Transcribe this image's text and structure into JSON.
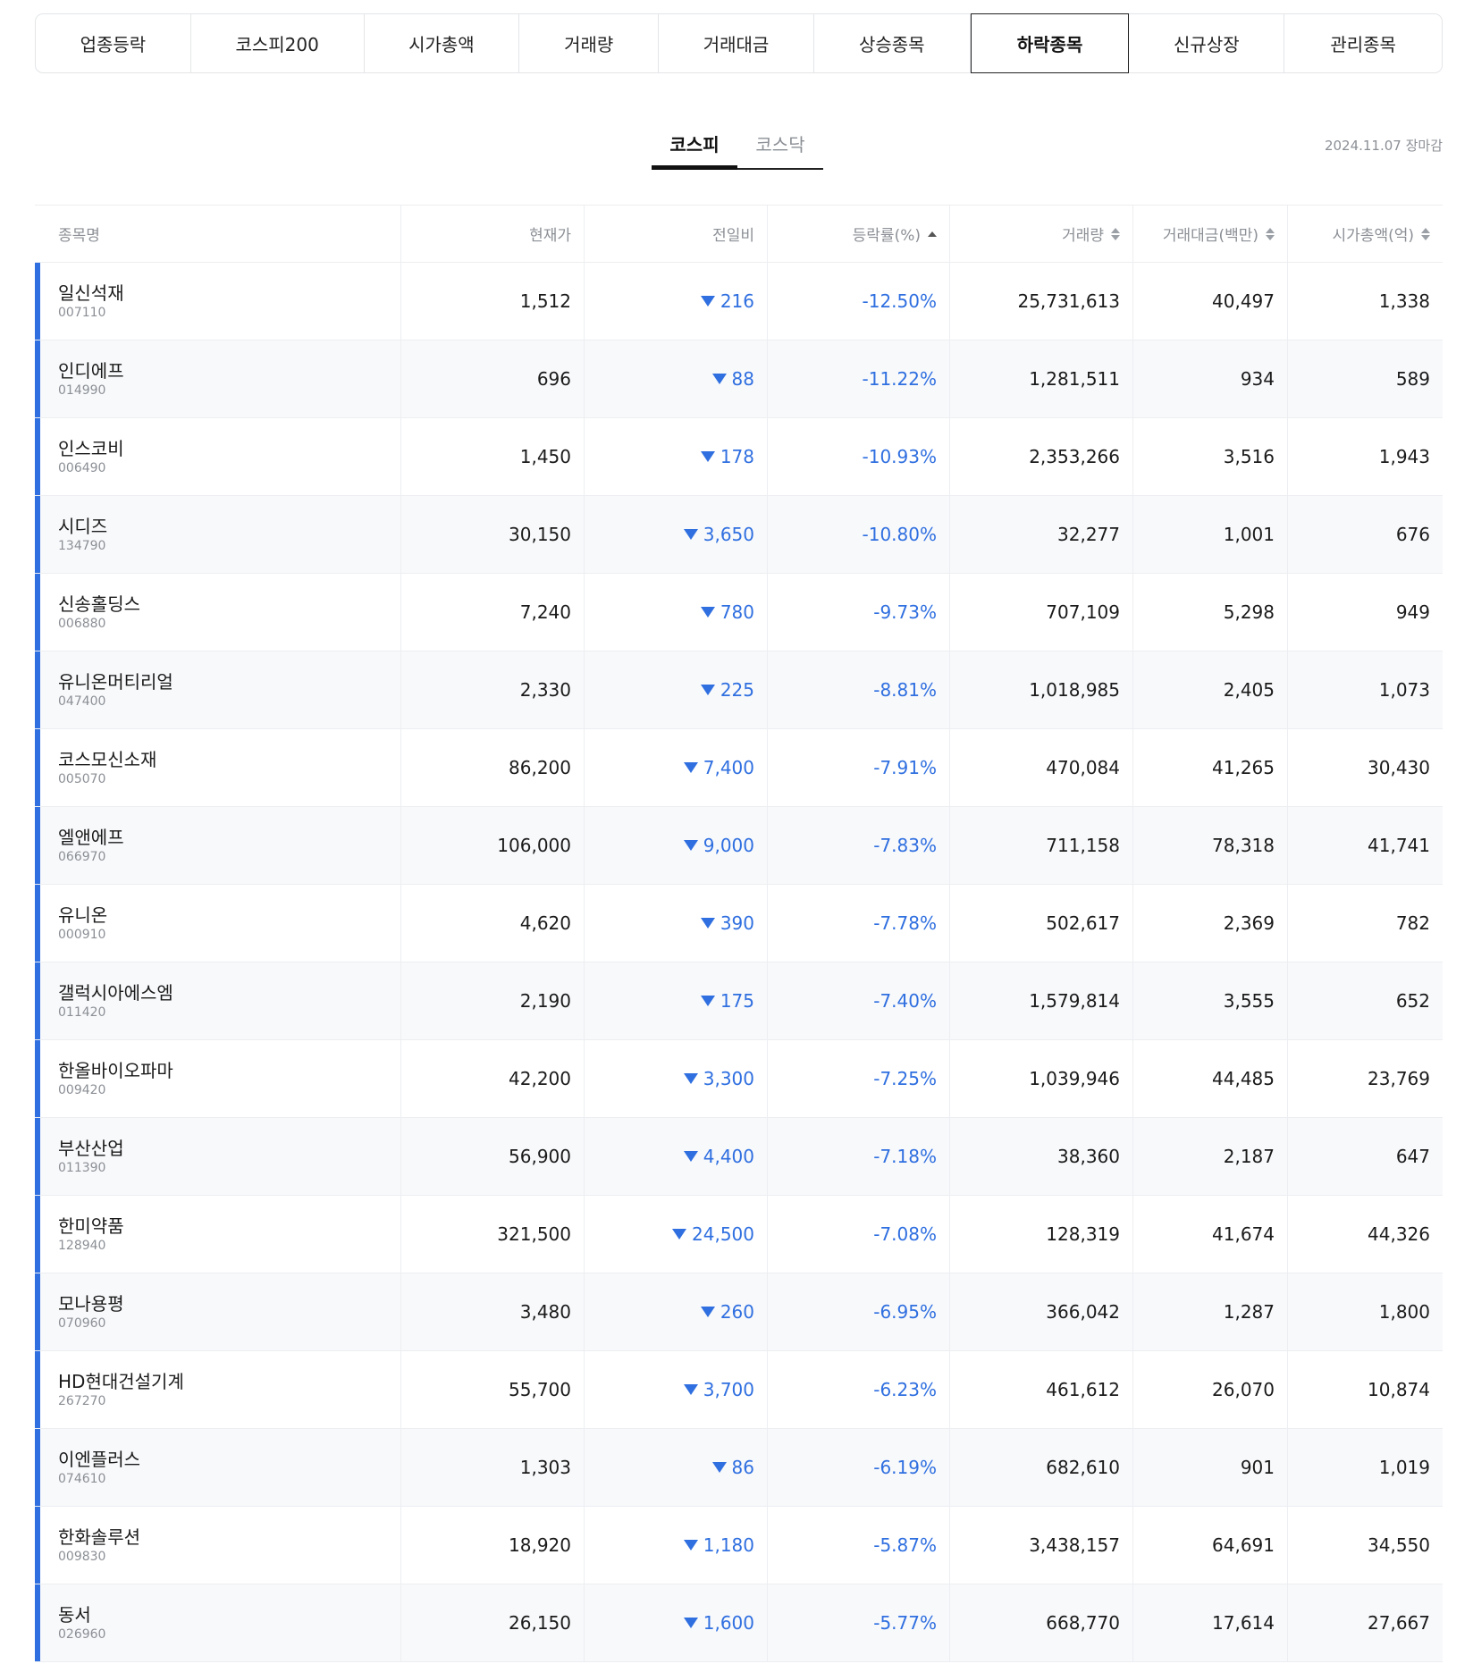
{
  "category_tabs": [
    {
      "label": "업종등락",
      "width": 174
    },
    {
      "label": "코스피200",
      "width": 194
    },
    {
      "label": "시가총액",
      "width": 174
    },
    {
      "label": "거래량",
      "width": 156
    },
    {
      "label": "거래대금",
      "width": 174
    },
    {
      "label": "상승종목",
      "width": 175
    },
    {
      "label": "하락종목",
      "width": 178
    },
    {
      "label": "신규상장",
      "width": 174
    },
    {
      "label": "관리종목",
      "width": 176
    }
  ],
  "active_category": "하락종목",
  "market_tabs": [
    "코스피",
    "코스닥"
  ],
  "active_market": "코스피",
  "date_label": "2024.11.07 장마감",
  "columns": [
    "종목명",
    "현재가",
    "전일비",
    "등락률(%)",
    "거래량",
    "거래대금(백만)",
    "시가총액(억)"
  ],
  "rows": [
    {
      "name": "일신석재",
      "code": "007110",
      "price": "1,512",
      "change": "216",
      "rate": "-12.50%",
      "volume": "25,731,613",
      "value": "40,497",
      "cap": "1,338"
    },
    {
      "name": "인디에프",
      "code": "014990",
      "price": "696",
      "change": "88",
      "rate": "-11.22%",
      "volume": "1,281,511",
      "value": "934",
      "cap": "589"
    },
    {
      "name": "인스코비",
      "code": "006490",
      "price": "1,450",
      "change": "178",
      "rate": "-10.93%",
      "volume": "2,353,266",
      "value": "3,516",
      "cap": "1,943"
    },
    {
      "name": "시디즈",
      "code": "134790",
      "price": "30,150",
      "change": "3,650",
      "rate": "-10.80%",
      "volume": "32,277",
      "value": "1,001",
      "cap": "676"
    },
    {
      "name": "신송홀딩스",
      "code": "006880",
      "price": "7,240",
      "change": "780",
      "rate": "-9.73%",
      "volume": "707,109",
      "value": "5,298",
      "cap": "949"
    },
    {
      "name": "유니온머티리얼",
      "code": "047400",
      "price": "2,330",
      "change": "225",
      "rate": "-8.81%",
      "volume": "1,018,985",
      "value": "2,405",
      "cap": "1,073"
    },
    {
      "name": "코스모신소재",
      "code": "005070",
      "price": "86,200",
      "change": "7,400",
      "rate": "-7.91%",
      "volume": "470,084",
      "value": "41,265",
      "cap": "30,430"
    },
    {
      "name": "엘앤에프",
      "code": "066970",
      "price": "106,000",
      "change": "9,000",
      "rate": "-7.83%",
      "volume": "711,158",
      "value": "78,318",
      "cap": "41,741"
    },
    {
      "name": "유니온",
      "code": "000910",
      "price": "4,620",
      "change": "390",
      "rate": "-7.78%",
      "volume": "502,617",
      "value": "2,369",
      "cap": "782"
    },
    {
      "name": "갤럭시아에스엠",
      "code": "011420",
      "price": "2,190",
      "change": "175",
      "rate": "-7.40%",
      "volume": "1,579,814",
      "value": "3,555",
      "cap": "652"
    },
    {
      "name": "한올바이오파마",
      "code": "009420",
      "price": "42,200",
      "change": "3,300",
      "rate": "-7.25%",
      "volume": "1,039,946",
      "value": "44,485",
      "cap": "23,769"
    },
    {
      "name": "부산산업",
      "code": "011390",
      "price": "56,900",
      "change": "4,400",
      "rate": "-7.18%",
      "volume": "38,360",
      "value": "2,187",
      "cap": "647"
    },
    {
      "name": "한미약품",
      "code": "128940",
      "price": "321,500",
      "change": "24,500",
      "rate": "-7.08%",
      "volume": "128,319",
      "value": "41,674",
      "cap": "44,326"
    },
    {
      "name": "모나용평",
      "code": "070960",
      "price": "3,480",
      "change": "260",
      "rate": "-6.95%",
      "volume": "366,042",
      "value": "1,287",
      "cap": "1,800"
    },
    {
      "name": "HD현대건설기계",
      "code": "267270",
      "price": "55,700",
      "change": "3,700",
      "rate": "-6.23%",
      "volume": "461,612",
      "value": "26,070",
      "cap": "10,874"
    },
    {
      "name": "이엔플러스",
      "code": "074610",
      "price": "1,303",
      "change": "86",
      "rate": "-6.19%",
      "volume": "682,610",
      "value": "901",
      "cap": "1,019"
    },
    {
      "name": "한화솔루션",
      "code": "009830",
      "price": "18,920",
      "change": "1,180",
      "rate": "-5.87%",
      "volume": "3,438,157",
      "value": "64,691",
      "cap": "34,550"
    },
    {
      "name": "동서",
      "code": "026960",
      "price": "26,150",
      "change": "1,600",
      "rate": "-5.77%",
      "volume": "668,770",
      "value": "17,614",
      "cap": "27,667"
    }
  ],
  "colors": {
    "down": "#2f6fe0",
    "border": "#eceef1",
    "muted": "#8b8f95"
  }
}
